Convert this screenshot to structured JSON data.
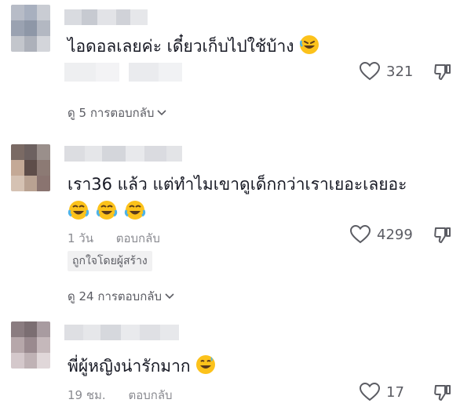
{
  "comments": [
    {
      "text": "ไอดอลเลยค่ะ เดี๋ยวเก็บไปใช้บ้าง",
      "emoji": "rolling-laughing-emoji",
      "likes": "321",
      "view_replies": "ดู 5 การตอบกลับ"
    },
    {
      "text": "เรา36 แล้ว แต่ทำไมเขาดูเด็กกว่าเราเยอะเลยอะ",
      "emoji": "tears-of-joy-emoji",
      "time": "1 วัน",
      "reply": "ตอบกลับ",
      "likes": "4299",
      "liked_by_creator": "ถูกใจโดยผู้สร้าง",
      "view_replies": "ดู 24 การตอบกลับ"
    },
    {
      "text": "พี่ผู้หญิงน่ารักมาก",
      "emoji": "grinning-sweat-emoji",
      "time": "19 ชม.",
      "reply": "ตอบกลับ",
      "likes": "17"
    }
  ],
  "colors": {
    "text": "#161823",
    "muted": "#8a8b91",
    "icon": "#5b5c63"
  }
}
